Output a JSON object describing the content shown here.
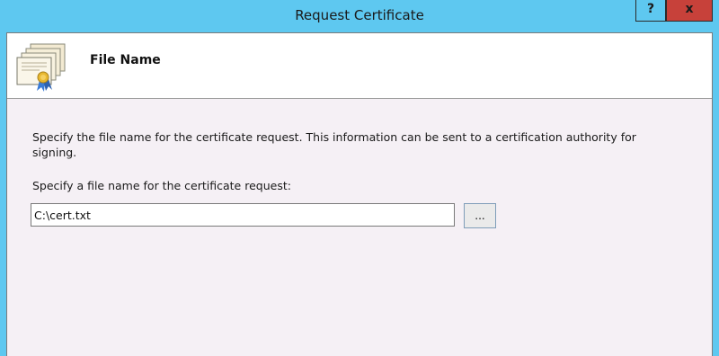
{
  "window": {
    "title": "Request Certificate",
    "help_label": "?",
    "close_label": "x"
  },
  "header": {
    "title": "File Name",
    "icon": "certificate-icon"
  },
  "main": {
    "description": "Specify the file name for the certificate request. This information can be sent to a certification authority for signing.",
    "field_label": "Specify a file name for the certificate request:",
    "file_value": "C:\\cert.txt",
    "browse_label": "..."
  },
  "colors": {
    "titlebar": "#5ec8f0",
    "close_button": "#c7413a",
    "client_background": "#f5f0f5",
    "header_background": "#ffffff"
  }
}
